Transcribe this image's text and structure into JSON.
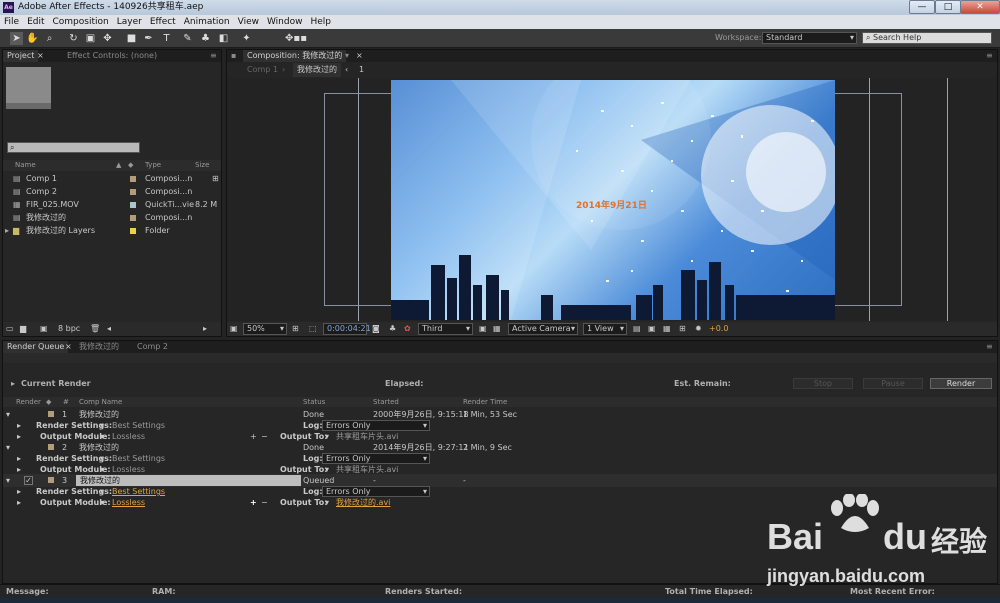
{
  "app": {
    "title": "Adobe After Effects - 140926共享租车.aep",
    "icon": "Ae"
  },
  "window_buttons": [
    "—",
    "□",
    "✕"
  ],
  "menu": [
    "File",
    "Edit",
    "Composition",
    "Layer",
    "Effect",
    "Animation",
    "View",
    "Window",
    "Help"
  ],
  "workspace": {
    "label": "Workspace:",
    "value": "Standard"
  },
  "search_help": {
    "placeholder": "Search Help"
  },
  "project_panel": {
    "tab": "Project",
    "effect_controls_tab": "Effect Controls: (none)",
    "columns": {
      "name": "Name",
      "type": "Type",
      "size": "Size"
    },
    "items": [
      {
        "name": "Comp 1",
        "type": "Composi...n",
        "size": "",
        "color": "#b39c7a"
      },
      {
        "name": "Comp 2",
        "type": "Composi...n",
        "size": "",
        "color": "#b39c7a"
      },
      {
        "name": "FIR_025.MOV",
        "type": "QuickTi...vie",
        "size": "8.2 M",
        "color": "#a9c6c6"
      },
      {
        "name": "我修改过的",
        "type": "Composi...n",
        "size": "",
        "color": "#b39c7a"
      },
      {
        "name": "我修改过的 Layers",
        "type": "Folder",
        "size": "",
        "color": "#e6d44a"
      }
    ],
    "bpc": "8 bpc"
  },
  "composition_panel": {
    "tab": "Composition: 我修改过的",
    "nav": [
      "Comp 1",
      "我修改过的",
      "1"
    ],
    "overlay_text": "2014年9月21日",
    "zoom": "50%",
    "timecode": "0:00:04:21",
    "resolution": "Third",
    "camera": "Active Camera",
    "view": "1 View",
    "exposure": "+0.0"
  },
  "render_queue": {
    "tabs": [
      "Render Queue",
      "我修改过的",
      "Comp 2"
    ],
    "current_render": "Current Render",
    "elapsed": "Elapsed:",
    "est_remain": "Est. Remain:",
    "buttons": {
      "stop": "Stop",
      "pause": "Pause",
      "render": "Render"
    },
    "columns": {
      "render": "Render",
      "num": "#",
      "comp": "Comp Name",
      "status": "Status",
      "started": "Started",
      "time": "Render Time"
    },
    "items": [
      {
        "num": "1",
        "comp": "我修改过的",
        "status": "Done",
        "started": "2000年9月26日, 9:15:18",
        "time": "1 Min, 53 Sec",
        "settings": "Best Settings",
        "log": "Errors Only",
        "module": "Lossless",
        "output": "共享租车片头.avi"
      },
      {
        "num": "2",
        "comp": "我修改过的",
        "status": "Done",
        "started": "2014年9月26日, 9:27:11",
        "time": "2 Min, 9 Sec",
        "settings": "Best Settings",
        "log": "Errors Only",
        "module": "Lossless",
        "output": "共享租车片头.avi"
      },
      {
        "num": "3",
        "comp": "我修改过的",
        "status": "Queued",
        "started": "-",
        "time": "-",
        "settings": "Best Settings",
        "log": "Errors Only",
        "module": "Lossless",
        "output": "我修改过的.avi"
      }
    ],
    "labels": {
      "render_settings": "Render Settings:",
      "output_module": "Output Module:",
      "log": "Log:",
      "output_to": "Output To:"
    }
  },
  "status_bar": {
    "message": "Message:",
    "ram": "RAM:",
    "renders_started": "Renders Started:",
    "total_time": "Total Time Elapsed:",
    "recent_error": "Most Recent Error:"
  },
  "watermark": {
    "brand_a": "Bai",
    "brand_b": "du",
    "suffix": "经验",
    "url": "jingyan.baidu.com"
  }
}
